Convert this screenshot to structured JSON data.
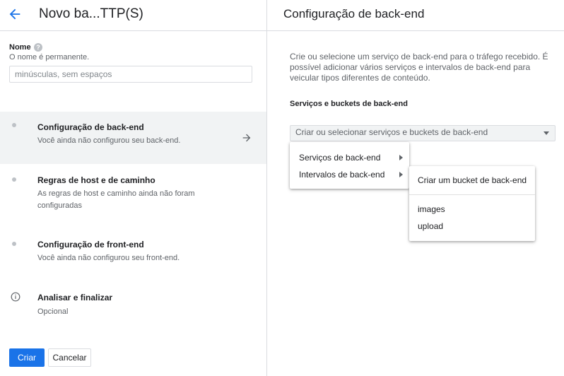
{
  "header": {
    "title": "Novo ba...TTP(S)"
  },
  "name_field": {
    "label": "Nome",
    "help_icon": "?",
    "hint": "O nome é permanente.",
    "placeholder": "minúsculas, sem espaços",
    "value": ""
  },
  "steps": [
    {
      "title": "Configuração de back-end",
      "subtitle": "Você ainda não configurou seu back-end.",
      "active": true
    },
    {
      "title": "Regras de host e de caminho",
      "subtitle": "As regras de host e caminho ainda não foram configuradas",
      "active": false
    },
    {
      "title": "Configuração de front-end",
      "subtitle": "Você ainda não configurou seu front-end.",
      "active": false
    },
    {
      "title": "Analisar e finalizar",
      "subtitle": "Opcional",
      "active": false
    }
  ],
  "buttons": {
    "create": "Criar",
    "cancel": "Cancelar"
  },
  "panel": {
    "title": "Configuração de back-end",
    "description": "Crie ou selecione um serviço de back-end para o tráfego recebido. É possível adicionar vários serviços e intervalos de back-end para veicular tipos diferentes de conteúdo.",
    "section_label": "Serviços e buckets de back-end",
    "select_value": "Criar ou selecionar serviços e buckets de back-end"
  },
  "menu": {
    "items": [
      {
        "label": "Serviços de back-end"
      },
      {
        "label": "Intervalos de back-end"
      }
    ]
  },
  "submenu": {
    "items": [
      {
        "label": "Criar um bucket de back-end"
      },
      {
        "label": "images"
      },
      {
        "label": "upload"
      }
    ]
  },
  "colors": {
    "accent": "#1a73e8",
    "active_step_bg": "#f1f3f4",
    "border": "#dadce0"
  },
  "icons": {
    "back": "arrow-left-icon",
    "help": "help-icon",
    "step_arrow": "arrow-right-icon",
    "info": "info-icon"
  }
}
